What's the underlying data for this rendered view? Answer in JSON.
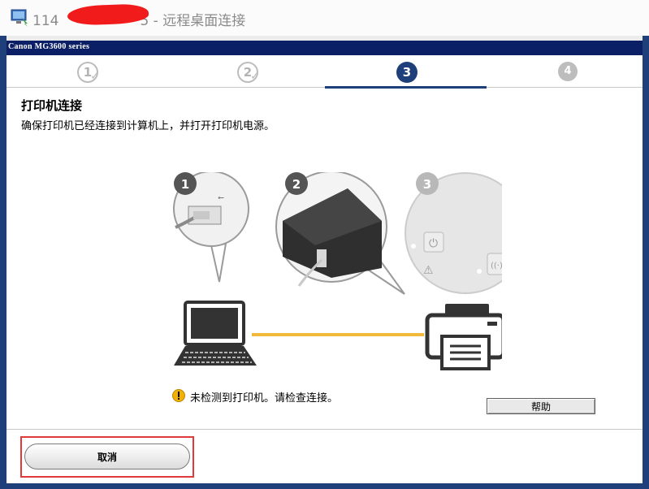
{
  "remote_window": {
    "title_prefix": "114",
    "title_suffix": "5 - 远程桌面连接",
    "icon": "remote-desktop-icon"
  },
  "app": {
    "title": "Canon MG3600 series"
  },
  "wizard": {
    "steps": [
      {
        "label": "1",
        "state": "done"
      },
      {
        "label": "2",
        "state": "done"
      },
      {
        "label": "3",
        "state": "active"
      },
      {
        "label": "4",
        "state": "future"
      }
    ],
    "check_glyph": "✓",
    "section_title": "打印机连接",
    "section_desc": "确保打印机已经连接到计算机上，并打开打印机电源。",
    "illustration": {
      "callouts": [
        "1",
        "2",
        "3"
      ]
    },
    "status": {
      "icon": "warning-icon",
      "text": "未检测到打印机。请检查连接。"
    },
    "help_label": "帮助",
    "cancel_label": "取消"
  },
  "colors": {
    "frame": "#1f3f7a",
    "app_titlebar": "#0a1f66",
    "cable": "#f0b93a",
    "highlight": "#e23a3a"
  }
}
